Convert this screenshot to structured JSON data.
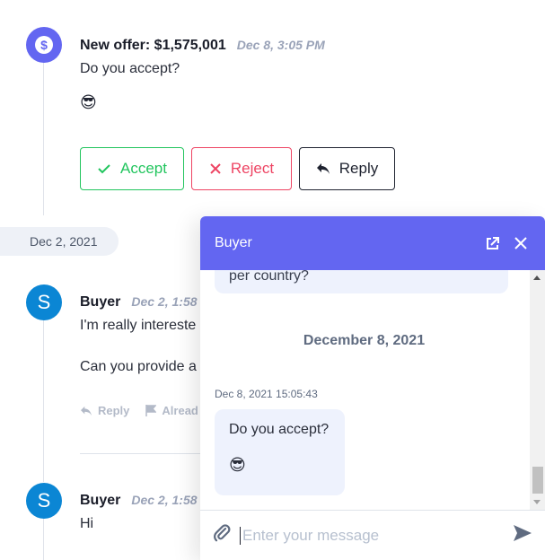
{
  "offer": {
    "icon": "dollar-icon",
    "title": "New offer: $1,575,001",
    "time": "Dec 8, 3:05 PM",
    "text": "Do you accept?",
    "emoji": "😎",
    "buttons": {
      "accept": "Accept",
      "reject": "Reject",
      "reply": "Reply"
    }
  },
  "date_chip": "Dec 2, 2021",
  "messages": [
    {
      "avatar": "S",
      "author": "Buyer",
      "time": "Dec 2, 1:58",
      "lines": [
        "I'm really intereste",
        "Can you provide a"
      ],
      "actions": {
        "reply": "Reply",
        "flag": "Alread"
      }
    },
    {
      "avatar": "S",
      "author": "Buyer",
      "time": "Dec 2, 1:58",
      "lines": [
        "Hi"
      ]
    }
  ],
  "chat": {
    "title": "Buyer",
    "prev_bubble_text": "per country?",
    "date_separator": "December 8, 2021",
    "timestamp": "Dec 8, 2021 15:05:43",
    "bubble_text": "Do you accept?",
    "bubble_emoji": "😎",
    "input_placeholder": "Enter your message"
  },
  "colors": {
    "accent": "#6366f1",
    "accept": "#22c55e",
    "reject": "#ee4463",
    "avatar": "#0b86d4"
  }
}
